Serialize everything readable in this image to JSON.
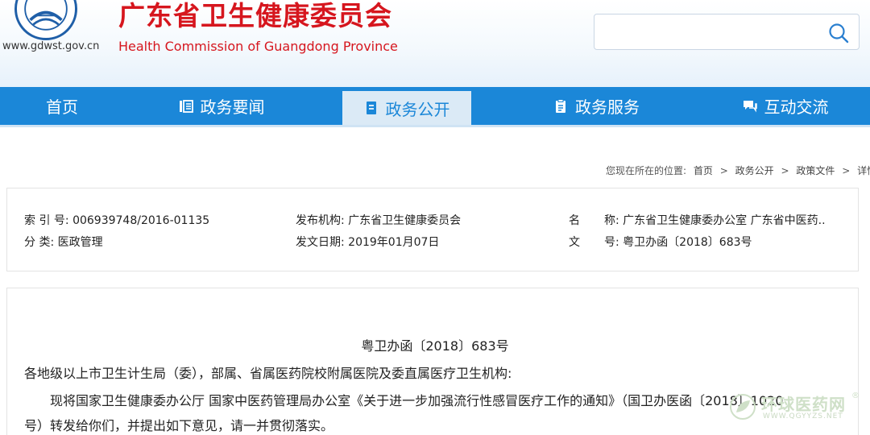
{
  "header": {
    "site_url": "www.gdwst.gov.cn",
    "title_cn": "广东省卫生健康委员会",
    "title_en": "Health Commission of Guangdong Province",
    "search_value": ""
  },
  "nav": {
    "items": [
      {
        "label": "首页",
        "icon": ""
      },
      {
        "label": "政务要闻",
        "icon": "news-icon"
      },
      {
        "label": "政务公开",
        "icon": "document-icon",
        "active": true
      },
      {
        "label": "政务服务",
        "icon": "clipboard-icon"
      },
      {
        "label": "互动交流",
        "icon": "chat-icon"
      }
    ]
  },
  "breadcrumb": {
    "prefix": "您现在所在的位置:",
    "items": [
      "首页",
      "政务公开",
      "政策文件",
      "详情"
    ],
    "separator": ">"
  },
  "info": {
    "index_no": "索 引 号: 006939748/2016-01135",
    "category": "分 类: 医政管理",
    "publisher": "发布机构: 广东省卫生健康委员会",
    "issue_date": "发文日期: 2019年01月07日",
    "name_char": "名",
    "name_rest": "称: 广东省卫生健康委办公室 广东省中医药..",
    "doc_char": "文",
    "doc_rest": "号: 粤卫办函〔2018〕683号"
  },
  "content": {
    "doc_number": "粤卫办函〔2018〕683号",
    "addressee": "各地级以上市卫生计生局（委），部属、省属医药院校附属医院及委直属医疗卫生机构:",
    "para1_line1": "现将国家卫生健康委办公厅 国家中医药管理局办公室《关于进一步加强流行性感冒医疗工作的通知》（国卫办医函〔2018〕1020",
    "para1_line2": "号）转发给你们，并提出如下意见，请一并贯彻落实。"
  },
  "watermark": {
    "name": "环球医药网",
    "url": "WWW.QGYYZS.NET",
    "reg": "®"
  },
  "colors": {
    "brand_red": "#d6161e",
    "nav_blue": "#1b87d8",
    "nav_active_bg": "#dbeaf6"
  }
}
